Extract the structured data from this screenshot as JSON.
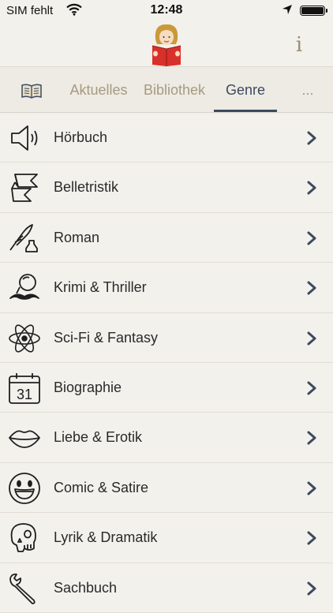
{
  "status_bar": {
    "carrier": "SIM fehlt",
    "time": "12:48"
  },
  "header": {
    "info_label": "i"
  },
  "tabs": [
    {
      "label": "Aktuelles"
    },
    {
      "label": "Bibliothek"
    },
    {
      "label": "Genre",
      "active": true
    },
    {
      "label": "..."
    }
  ],
  "genres": [
    {
      "label": "Hörbuch",
      "icon": "speaker-icon"
    },
    {
      "label": "Belletristik",
      "icon": "ribbon-icon"
    },
    {
      "label": "Roman",
      "icon": "quill-ink-icon"
    },
    {
      "label": "Krimi & Thriller",
      "icon": "magnifier-mustache-icon"
    },
    {
      "label": "Sci-Fi & Fantasy",
      "icon": "atom-icon"
    },
    {
      "label": "Biographie",
      "icon": "calendar-icon"
    },
    {
      "label": "Liebe & Erotik",
      "icon": "lips-icon"
    },
    {
      "label": "Comic & Satire",
      "icon": "smiley-icon"
    },
    {
      "label": "Lyrik & Dramatik",
      "icon": "skull-icon"
    },
    {
      "label": "Sachbuch",
      "icon": "wrench-icon"
    }
  ],
  "colors": {
    "accent": "#3c4a5e",
    "tab_inactive": "#a69a80",
    "background": "#f3f1ec"
  }
}
